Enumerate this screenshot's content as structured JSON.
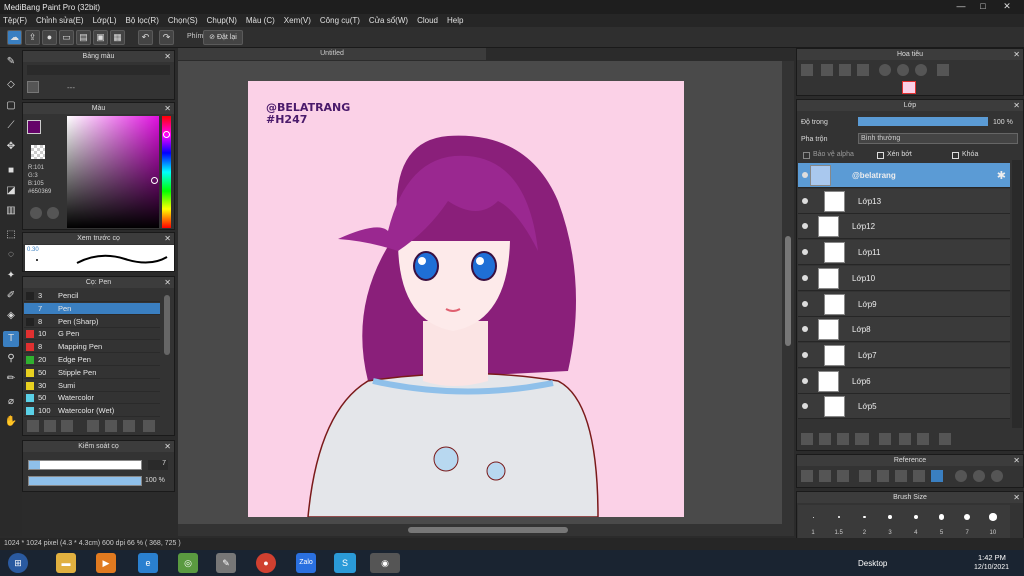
{
  "titlebar": {
    "title": "MediBang Paint Pro (32bit)",
    "minimize": "—",
    "maximize": "□",
    "close": "✕"
  },
  "menu": [
    "Tệp(F)",
    "Chỉnh sửa(E)",
    "Lớp(L)",
    "Bộ lọc(R)",
    "Chọn(S)",
    "Chụp(N)",
    "Màu (C)",
    "Xem(V)",
    "Công cụ(T)",
    "Cửa sổ(W)",
    "Cloud",
    "Help"
  ],
  "toolbar": {
    "phim": "Phím",
    "reset": "Đặt lại"
  },
  "panels": {
    "palette": {
      "title": "Bảng màu",
      "dash": "---"
    },
    "color": {
      "title": "Màu",
      "r": "R:101",
      "g": "G:3",
      "b": "B:105",
      "hex": "#650369"
    },
    "preview": {
      "title": "Xem trước cọ",
      "size": "0.30"
    },
    "brush": {
      "title": "Cọ: Pen",
      "items": [
        {
          "size": "3",
          "name": "Pencil",
          "color": "#222"
        },
        {
          "size": "7",
          "name": "Pen",
          "color": "#3a7fc1"
        },
        {
          "size": "8",
          "name": "Pen (Sharp)",
          "color": "#222"
        },
        {
          "size": "10",
          "name": "G Pen",
          "color": "#e03030"
        },
        {
          "size": "8",
          "name": "Mapping Pen",
          "color": "#e03030"
        },
        {
          "size": "20",
          "name": "Edge Pen",
          "color": "#30b030"
        },
        {
          "size": "50",
          "name": "Stipple Pen",
          "color": "#e8d020"
        },
        {
          "size": "30",
          "name": "Sumi",
          "color": "#e8d020"
        },
        {
          "size": "50",
          "name": "Watercolor",
          "color": "#5ad0e6"
        },
        {
          "size": "100",
          "name": "Watercolor (Wet)",
          "color": "#5ad0e6"
        }
      ]
    },
    "control": {
      "title": "Kiểm soát cọ",
      "size": "7",
      "opacity": "100 %",
      "size_level": 0.1,
      "opacity_level": 1.0
    }
  },
  "canvas": {
    "tab": "Untitled",
    "watermark1": "@BELATRANG",
    "watermark2": "#H247"
  },
  "navigator": {
    "title": "Hoa tiêu"
  },
  "layers": {
    "title": "Lớp",
    "opacity_label": "Độ trong",
    "opacity": "100 %",
    "opacity_level": 1.0,
    "blend_label": "Pha trộn",
    "blend": "Bình thường",
    "protect": "Bảo vệ alpha",
    "clip": "Xén bớt",
    "lock": "Khóa",
    "items": [
      {
        "name": "@belatrang",
        "selected": true
      },
      {
        "name": "Lớp13"
      },
      {
        "name": "Lớp12"
      },
      {
        "name": "Lớp11"
      },
      {
        "name": "Lớp10"
      },
      {
        "name": "Lớp9"
      },
      {
        "name": "Lớp8"
      },
      {
        "name": "Lớp7"
      },
      {
        "name": "Lớp6"
      },
      {
        "name": "Lớp5"
      }
    ]
  },
  "reference": {
    "title": "Reference"
  },
  "brushsize": {
    "title": "Brush Size",
    "values": [
      "1",
      "1.5",
      "2",
      "3",
      "4",
      "5",
      "7",
      "10"
    ]
  },
  "status": {
    "text": "1024 * 1024 pixel  (4.3 * 4.3cm)  600 dpi  66 %  ( 368, 725 )"
  },
  "taskbar": {
    "desktop": "Desktop",
    "time": "1:42 PM",
    "date": "12/10/2021"
  }
}
